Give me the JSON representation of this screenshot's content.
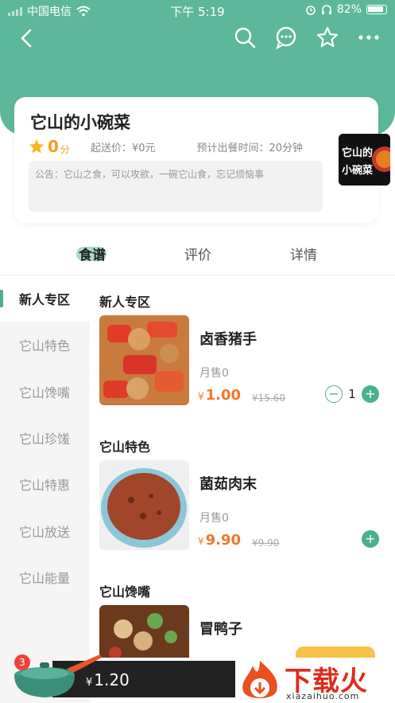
{
  "status_bar": {
    "carrier": "中国电信",
    "time": "下午 5:19",
    "battery": "82%"
  },
  "shop": {
    "name": "它山的小碗菜",
    "score": "0",
    "score_unit": "分",
    "min_send": "起送价：¥0元",
    "delivery_time": "预计出餐时间：20分钟",
    "notice": "公告：它山之食，可以攻欲，一碗它山食，忘记烦恼事",
    "logo_text": "它山的小碗菜"
  },
  "tabs": [
    {
      "label": "食谱"
    },
    {
      "label": "评价"
    },
    {
      "label": "详情"
    }
  ],
  "categories": [
    {
      "label": "新人专区"
    },
    {
      "label": "它山特色"
    },
    {
      "label": "它山馋嘴"
    },
    {
      "label": "它山珍馐"
    },
    {
      "label": "它山特惠"
    },
    {
      "label": "它山放送"
    },
    {
      "label": "它山能量"
    }
  ],
  "sections": [
    {
      "title": "新人专区",
      "product": {
        "name": "卤香猪手",
        "sold": "月售0",
        "currency": "¥",
        "price": "1.00",
        "original": "¥15.60",
        "qty": "1",
        "minus": "−",
        "plus": "+"
      }
    },
    {
      "title": "它山特色",
      "product": {
        "name": "菌茹肉末",
        "sold": "月售0",
        "currency": "¥",
        "price": "9.90",
        "original": "¥9.90",
        "plus": "+"
      }
    },
    {
      "title": "它山馋嘴",
      "product": {
        "name": "冒鸭子"
      }
    }
  ],
  "cart": {
    "count": "3",
    "currency": "¥",
    "total": "1.20"
  },
  "watermark": {
    "text": "下载火",
    "sub": "xiazaihuo.com"
  },
  "colors": {
    "primary": "#5db89b",
    "accent": "#4cb08e",
    "price": "#f2762d",
    "star": "#f0a020"
  }
}
